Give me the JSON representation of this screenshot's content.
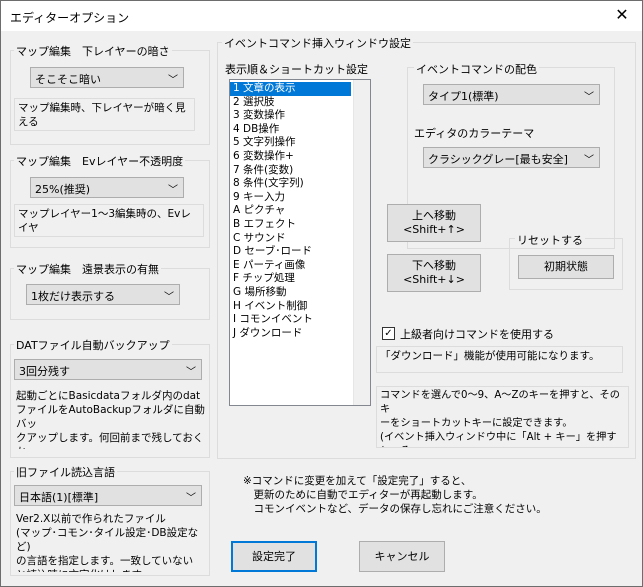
{
  "window": {
    "title": "エディターオプション",
    "close_icon": "✕"
  },
  "layer_darkness": {
    "label": "マップ編集　下レイヤーの暗さ",
    "value": "そこそこ暗い",
    "desc": "マップ編集時、下レイヤーが暗く見える\n度合いを設定します。"
  },
  "ev_opacity": {
    "label": "マップ編集　Evレイヤー不透明度",
    "value": "25%(推奨)",
    "desc": "マップレイヤー1～3編集時の、Evレイヤ\nー不透明度を設定します。"
  },
  "distant_view": {
    "label": "マップ編集　遠景表示の有無",
    "value": "1枚だけ表示する"
  },
  "dat_backup": {
    "label": "DATファイル自動バックアップ",
    "value": "3回分残す",
    "desc": "起動ごとにBasicdataフォルダ内のdat\nファイルをAutoBackupフォルダに自動バッ\nクアップします。何回前まで残しておくか\nをここで指定します。"
  },
  "old_file_lang": {
    "label": "旧ファイル読込言語",
    "value": "日本語(1)[標準]",
    "desc": "Ver2.X以前で作られたファイル\n(マップ･コモン･タイル設定･DB設定など)\nの言語を指定します。一致していない\nと読込時に文字化けします"
  },
  "event_window": {
    "label": "イベントコマンド挿入ウィンドウ設定",
    "order_label": "表示順＆ショートカット設定",
    "commands": [
      "1 文章の表示",
      "2 選択肢",
      "3 変数操作",
      "4 DB操作",
      "5 文字列操作",
      "6 変数操作+",
      "7 条件(変数)",
      "8 条件(文字列)",
      "9 キー入力",
      "A ピクチャ",
      "B エフェクト",
      "C サウンド",
      "D セーブ･ロード",
      "E パーティ画像",
      "F チップ処理",
      "G 場所移動",
      "H イベント制御",
      "I コモンイベント",
      "J ダウンロード"
    ],
    "color_label": "イベントコマンドの配色",
    "color_value": "タイプ1(標準)",
    "theme_label": "エディタのカラーテーマ",
    "theme_value": "クラシックグレー[最も安全]",
    "move_up": "上へ移動\n<Shift+↑>",
    "move_down": "下へ移動\n<Shift+↓>",
    "reset_label": "リセットする",
    "reset_button": "初期状態",
    "advanced_check": "上級者向けコマンドを使用する",
    "advanced_desc": "「ダウンロード」機能が使用可能になります。",
    "shortcut_desc": "コマンドを選んで0～9、A～Zのキーを押すと、そのキ\nーをショートカットキーに設定できます。\n(イベント挿入ウィンドウ中に「Alt + キー」を押すと、そ\nのコマンドを一発選択できます)"
  },
  "notice": "※コマンドに変更を加えて「設定完了」すると、\n　更新のために自動でエディターが再起動します。\n　コモンイベントなど、データの保存し忘れにご注意ください。",
  "buttons": {
    "ok": "設定完了",
    "cancel": "キャンセル"
  },
  "icons": {
    "dropdown": "﹀",
    "check": "✓"
  }
}
